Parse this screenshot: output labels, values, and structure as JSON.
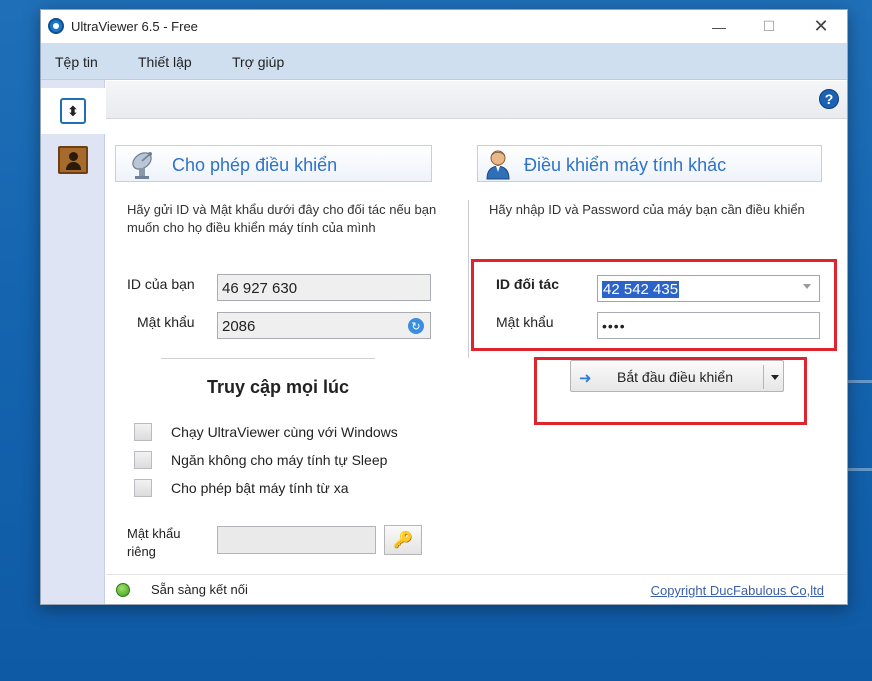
{
  "window": {
    "title": "UltraViewer 6.5 - Free",
    "controls": {
      "minimize": "—",
      "maximize": "☐",
      "close": "✕"
    }
  },
  "menu": {
    "items": [
      {
        "label": "Tệp tin"
      },
      {
        "label": "Thiết lập"
      },
      {
        "label": "Trợ giúp"
      }
    ]
  },
  "sidebar": {
    "items": [
      {
        "icon": "transfer-icon",
        "active": true
      },
      {
        "icon": "contacts-icon",
        "active": false
      }
    ]
  },
  "help_icon": "?",
  "allow_control": {
    "title": "Cho phép điều khiển",
    "icon": "satellite-dish-icon",
    "description": "Hãy gửi ID và Mật khẩu dưới đây cho đối tác nếu bạn muốn cho họ điều khiển máy tính của mình",
    "id_label": "ID của bạn",
    "id_value": "46 927 630",
    "password_label": "Mật khẩu",
    "password_value": "2086"
  },
  "remote_control": {
    "title": "Điều khiển máy tính khác",
    "icon": "user-icon",
    "description": "Hãy nhập ID và Password của máy bạn cần điều khiển",
    "partner_id_label": "ID đối tác",
    "partner_id_value": "42 542 435",
    "partner_password_label": "Mật khẩu",
    "partner_password_value": "••••",
    "connect_button": "Bắt đầu điều khiển"
  },
  "unattended": {
    "title": "Truy cập mọi lúc",
    "options": [
      {
        "label": "Chạy UltraViewer cùng với Windows",
        "checked": false
      },
      {
        "label": "Ngăn không cho máy tính tự Sleep",
        "checked": false
      },
      {
        "label": "Cho phép bật máy tính từ xa",
        "checked": false
      }
    ],
    "private_password_label": "Mật khẩu riêng",
    "private_password_value": ""
  },
  "status": {
    "text": "Sẵn sàng kết nối",
    "indicator_color": "#4caf2a",
    "copyright": "Copyright DucFabulous Co,ltd"
  },
  "colors": {
    "accent": "#2e73c8",
    "highlight": "#e0242e",
    "menubar": "#cfdff0",
    "desktop": "#1565b0"
  }
}
